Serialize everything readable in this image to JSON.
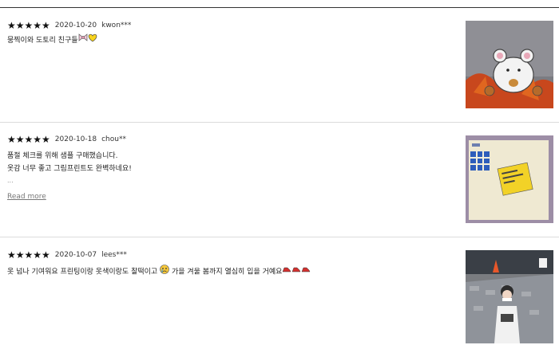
{
  "reviews": [
    {
      "stars": "★★★★★",
      "date": "2020-10-20",
      "user": "kwon***",
      "lines": [
        "뭉찍이와 도토리 친구들"
      ],
      "image_icon": "hamster-shirt-photo",
      "emoji": [
        "bow-icon",
        "yellow-heart-icon"
      ]
    },
    {
      "stars": "★★★★★",
      "date": "2020-10-18",
      "user": "chou**",
      "lines": [
        "품절 체크를 위해 샘플 구매했습니다.",
        "옷감 너무 좋고 그림프린트도 완벽하네요!"
      ],
      "ellipsis": "...",
      "read_more": "Read more",
      "image_icon": "folded-shirt-photo"
    },
    {
      "stars": "★★★★★",
      "date": "2020-10-07",
      "user": "lees***",
      "lines": [
        "옷 넘나 기여워요 프린팅이랑 옷색이랑도 찰떡이고",
        "가을 겨울 봄까지 열심히 입을 거예요"
      ],
      "image_icon": "street-photo",
      "emoji": [
        "crying-face-icon",
        "running-shoe-icon"
      ]
    }
  ]
}
